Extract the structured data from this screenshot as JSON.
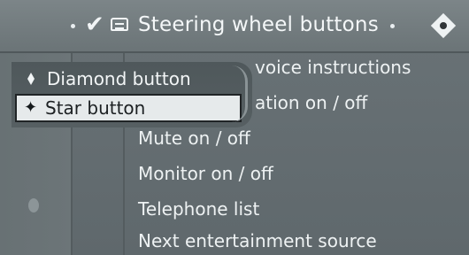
{
  "header": {
    "title": "Steering wheel buttons",
    "check_mark": "✔"
  },
  "popup": {
    "items": [
      {
        "label": "Diamond button",
        "icon": "diamond-icon"
      },
      {
        "label": "Star button",
        "icon": "star-icon",
        "star": "✦"
      }
    ]
  },
  "list": {
    "items": [
      "voice instructions",
      "ation on / off",
      "Mute on / off",
      "Monitor on / off",
      "Telephone list",
      "Next entertainment source"
    ]
  },
  "colors": {
    "background": "#5f686c",
    "text": "#eef2f3",
    "highlight": "#e6eaeb"
  }
}
